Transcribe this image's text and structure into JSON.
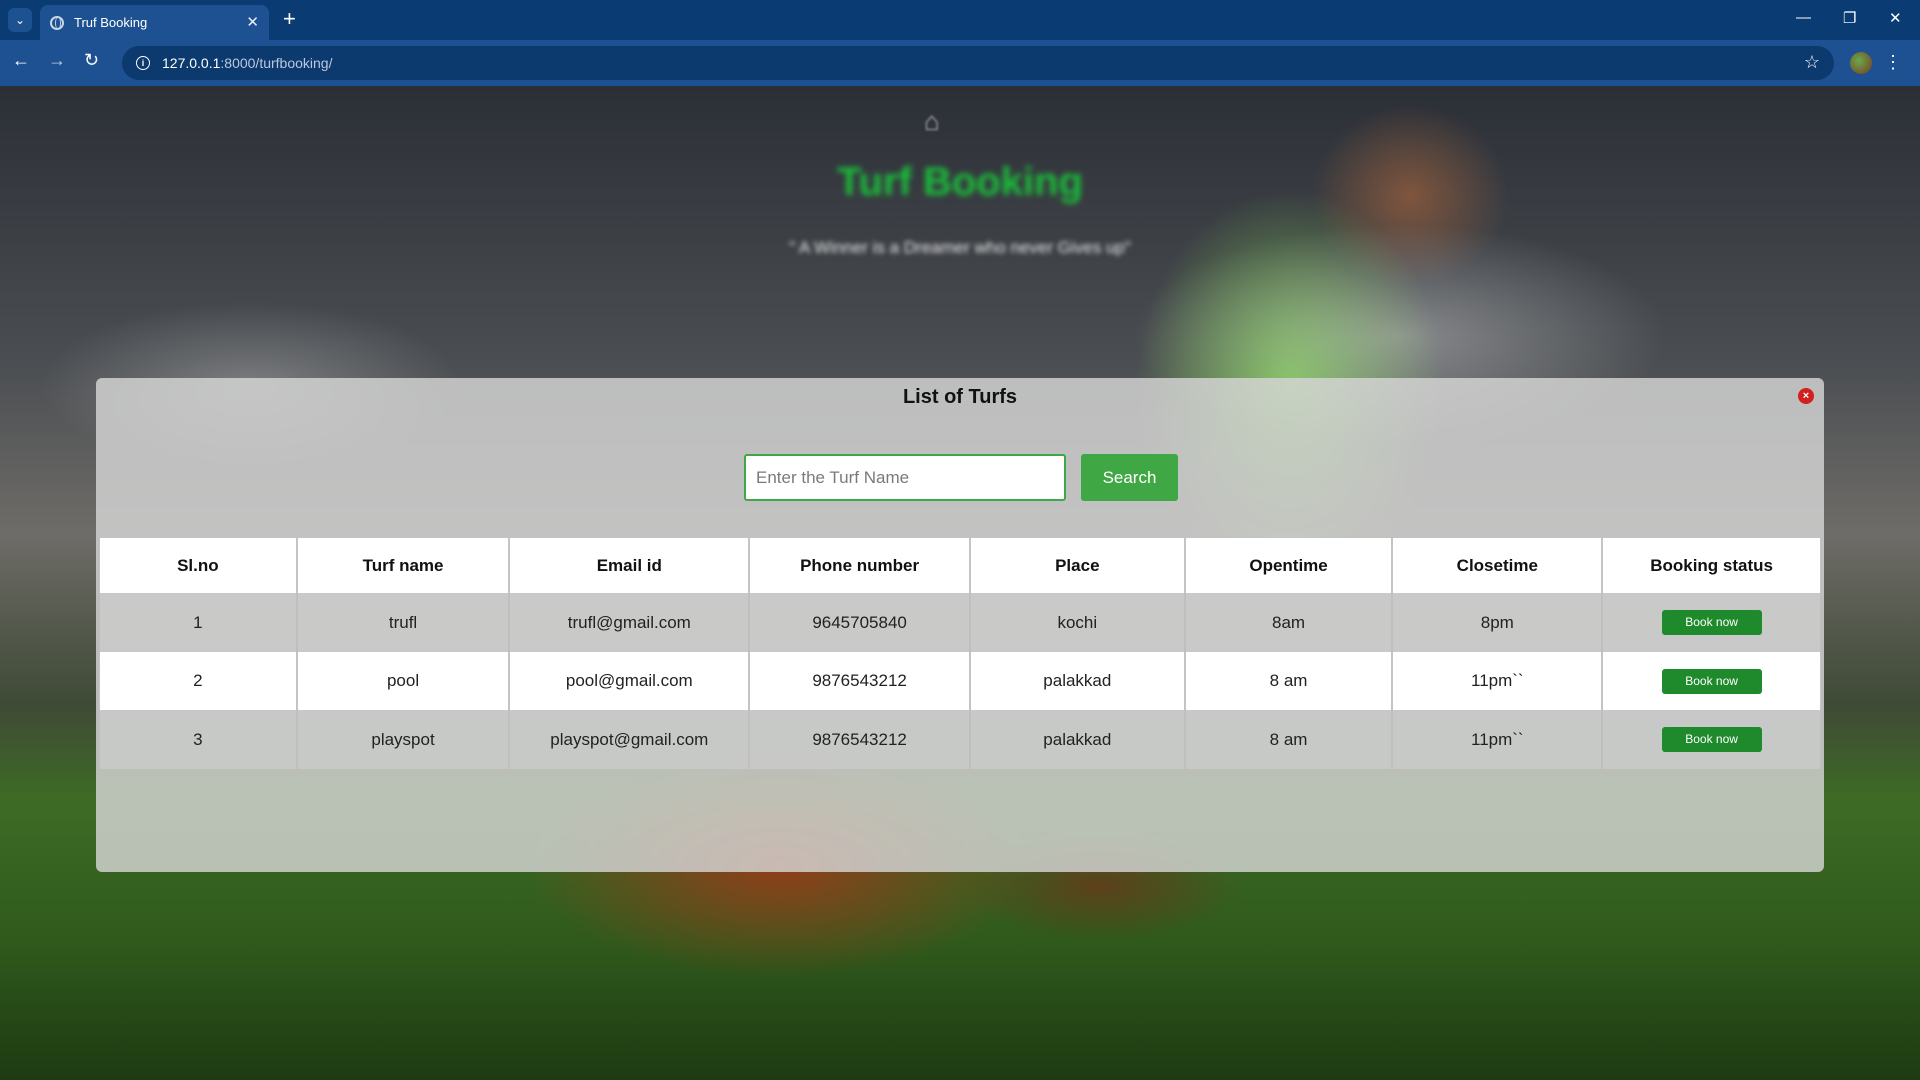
{
  "browser": {
    "tab_title": "Truf Booking",
    "url_host": "127.0.0.1",
    "url_path": ":8000/turfbooking/"
  },
  "hero": {
    "title": "Turf Booking",
    "quote": "\" A Winner is a Dreamer who never Gives up\""
  },
  "modal": {
    "title": "List of Turfs",
    "search_placeholder": "Enter the Turf Name",
    "search_label": "Search",
    "close_label": "×"
  },
  "table": {
    "headers": [
      "Sl.no",
      "Turf name",
      "Email id",
      "Phone number",
      "Place",
      "Opentime",
      "Closetime",
      "Booking status"
    ],
    "rows": [
      [
        "1",
        "trufl",
        "trufl@gmail.com",
        "9645705840",
        "kochi",
        "8am",
        "8pm"
      ],
      [
        "2",
        "pool",
        "pool@gmail.com",
        "9876543212",
        "palakkad",
        "8 am",
        "11pm``"
      ],
      [
        "3",
        "playspot",
        "playspot@gmail.com",
        "9876543212",
        "palakkad",
        "8 am",
        "11pm``"
      ]
    ],
    "book_label": "Book now"
  },
  "colors": {
    "accent": "#3fa844",
    "book_button": "#1f8a2c",
    "close": "#d21f1f",
    "chrome": "#1d5191"
  }
}
